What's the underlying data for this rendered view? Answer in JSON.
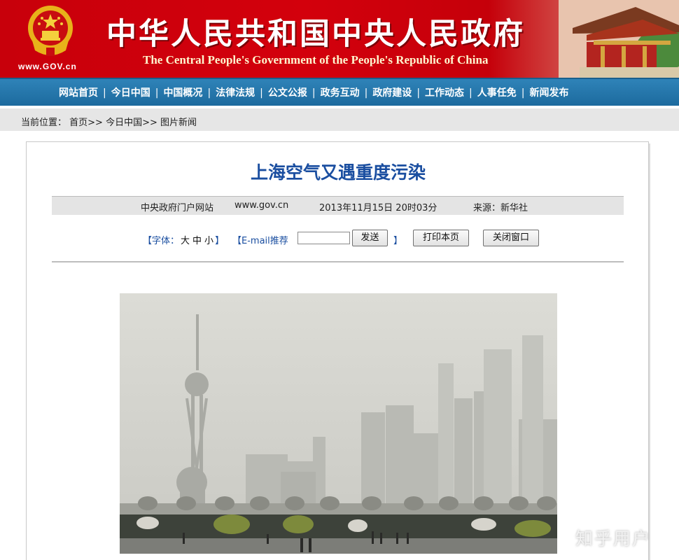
{
  "header": {
    "title_cn": "中华人民共和国中央人民政府",
    "title_en": "The Central People's Government of the People's Republic of China",
    "site_url": "www.GOV.cn",
    "colors": {
      "banner_red": "#d3000c",
      "nav_blue": "#2577ab"
    }
  },
  "nav": {
    "items": [
      "网站首页",
      "今日中国",
      "中国概况",
      "法律法规",
      "公文公报",
      "政务互动",
      "政府建设",
      "工作动态",
      "人事任免",
      "新闻发布"
    ],
    "separator": "|"
  },
  "breadcrumb": {
    "label": "当前位置：",
    "items": [
      "首页>>",
      "今日中国>>",
      "图片新闻"
    ]
  },
  "article": {
    "title": "上海空气又遇重度污染",
    "site": "中央政府门户网站",
    "url": "www.gov.cn",
    "datetime": "2013年11月15日 20时03分",
    "source": "来源：新华社"
  },
  "tools": {
    "font_label_open": "【字体：",
    "font_sizes": [
      "大",
      "中",
      "小"
    ],
    "font_label_close": "】",
    "email_label": "【E-mail推荐",
    "email_value": "",
    "send_button": "发送",
    "email_close": "】",
    "print_button": "打印本页",
    "close_button": "关闭窗口"
  },
  "watermark": "知乎用户"
}
